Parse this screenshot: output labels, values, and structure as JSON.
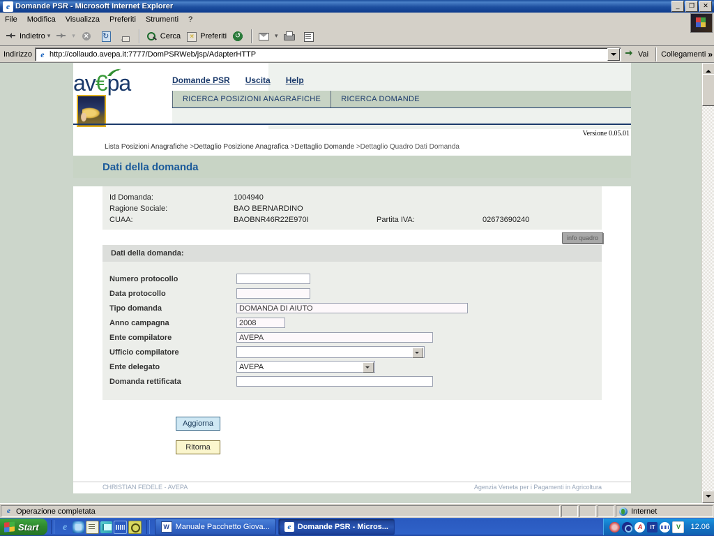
{
  "window": {
    "title": "Domande PSR - Microsoft Internet Explorer",
    "icon": "ie-icon",
    "minimize": "_",
    "maximize": "❐",
    "close": "✕"
  },
  "menubar": {
    "items": [
      {
        "label": "File"
      },
      {
        "label": "Modifica"
      },
      {
        "label": "Visualizza"
      },
      {
        "label": "Preferiti"
      },
      {
        "label": "Strumenti"
      },
      {
        "label": "?"
      }
    ]
  },
  "toolbar": {
    "back": "Indietro",
    "forward": "",
    "stop": "",
    "refresh": "",
    "home": "",
    "search": "Cerca",
    "favorites": "Preferiti",
    "history": "",
    "mail": "",
    "print": "",
    "edit": ""
  },
  "address": {
    "label": "Indirizzo",
    "url": "http://collaudo.avepa.it:7777/DomPSRWeb/jsp/AdapterHTTP",
    "go_label": "Vai",
    "links_label": "Collegamenti",
    "links_chevron": "»"
  },
  "site": {
    "logo_av": "av",
    "logo_e": "€",
    "logo_pa": "pa",
    "nav": [
      {
        "label": "Domande PSR"
      },
      {
        "label": "Uscita"
      },
      {
        "label": "Help"
      }
    ],
    "tabs": [
      {
        "label": "RICERCA POSIZIONI ANAGRAFICHE",
        "active": true
      },
      {
        "label": "RICERCA DOMANDE",
        "active": false
      }
    ],
    "version": "Versione 0.05.01"
  },
  "breadcrumb": {
    "items": [
      "Lista Posizioni Anagrafiche",
      "Dettaglio Posizione Anagrafica",
      "Dettaglio Domande",
      "Dettaglio Quadro Dati Domanda"
    ],
    "separator": ">"
  },
  "page": {
    "title": "Dati della domanda",
    "section_title": "Dati della domanda:",
    "info_button": "info quadro"
  },
  "info": {
    "id_label": "Id Domanda:",
    "id_value": "1004940",
    "ragione_label": "Ragione Sociale:",
    "ragione_value": "BAO BERNARDINO",
    "cuaa_label": "CUAA:",
    "cuaa_value": "BAOBNR46R22E970I",
    "piva_label": "Partita IVA:",
    "piva_value": "02673690240"
  },
  "form": {
    "fields": [
      {
        "label": "Numero protocollo",
        "value": "",
        "type": "text"
      },
      {
        "label": "Data protocollo",
        "value": "",
        "type": "text"
      },
      {
        "label": "Tipo domanda",
        "value": "DOMANDA DI AIUTO",
        "type": "text"
      },
      {
        "label": "Anno campagna",
        "value": "2008",
        "type": "text"
      },
      {
        "label": "Ente compilatore",
        "value": "AVEPA",
        "type": "text"
      },
      {
        "label": "Ufficio compilatore",
        "value": "",
        "type": "select"
      },
      {
        "label": "Ente delegato",
        "value": "AVEPA",
        "type": "select"
      },
      {
        "label": "Domanda rettificata",
        "value": "",
        "type": "text"
      }
    ]
  },
  "buttons": {
    "update": "Aggiorna",
    "return": "Ritorna"
  },
  "footer": {
    "left": "CHRISTIAN FEDELE - AVEPA",
    "right": "Agenzia Veneta per i Pagamenti in Agricoltura"
  },
  "statusbar": {
    "message": "Operazione completata",
    "zone": "Internet"
  },
  "taskbar": {
    "start": "Start",
    "tasks": [
      {
        "label": "Manuale Pacchetto Giova...",
        "icon": "word-icon",
        "active": false
      },
      {
        "label": "Domande PSR - Micros...",
        "icon": "ie-icon",
        "active": true
      }
    ],
    "tray": [
      "♪",
      "",
      "A",
      "IT",
      "",
      "V"
    ],
    "time": "12.06"
  }
}
